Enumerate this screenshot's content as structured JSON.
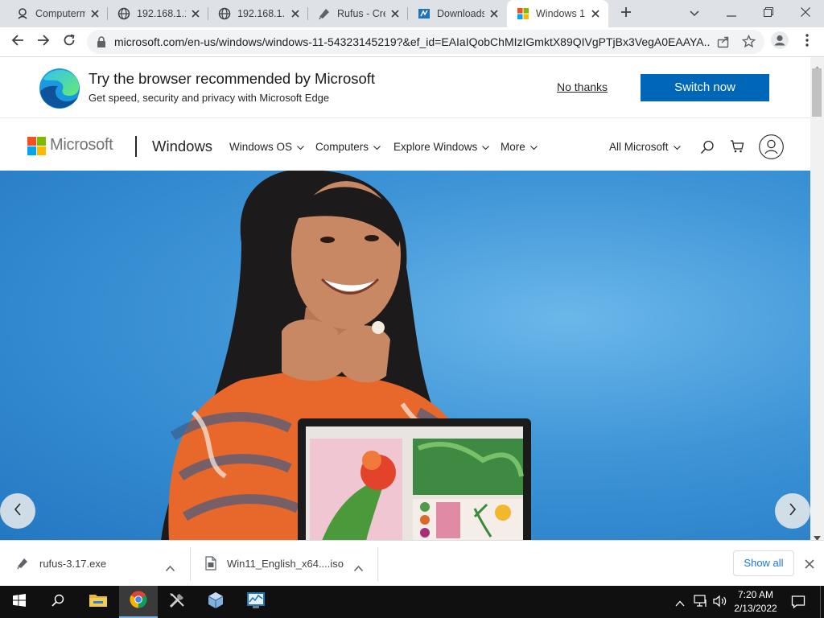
{
  "browser": {
    "tabs": [
      {
        "title": "Computerm",
        "icon": "computerm-icon"
      },
      {
        "title": "192.168.1.1",
        "icon": "globe-icon"
      },
      {
        "title": "192.168.1.1",
        "icon": "globe-icon"
      },
      {
        "title": "Rufus - Cre",
        "icon": "rufus-icon"
      },
      {
        "title": "Downloads",
        "icon": "downloads-site-icon"
      },
      {
        "title": "Windows 1",
        "icon": "windows-logo-icon"
      }
    ],
    "new_tab_icon": "plus-icon",
    "url": "microsoft.com/en-us/windows/windows-11-54323145219?&ef_id=EAIaIQobChMIzIGmktX89QIVgPTjBx3VegA0EAAYA..."
  },
  "edge_banner": {
    "title": "Try the browser recommended by Microsoft",
    "subtitle": "Get speed, security and privacy with Microsoft Edge",
    "no_thanks": "No thanks",
    "switch_now": "Switch now"
  },
  "ms_header": {
    "brand": "Microsoft",
    "product": "Windows",
    "nav": [
      "Windows OS",
      "Computers",
      "Explore Windows",
      "More"
    ],
    "all_microsoft": "All Microsoft"
  },
  "downloads": {
    "items": [
      {
        "name": "rufus-3.17.exe",
        "icon": "rufus-file-icon"
      },
      {
        "name": "Win11_English_x64....iso",
        "icon": "iso-file-icon"
      }
    ],
    "show_all": "Show all"
  },
  "taskbar": {
    "time": "7:20 AM",
    "date": "2/13/2022"
  },
  "colors": {
    "accent": "#0067b8",
    "hero_blue": "#3d94d6"
  }
}
